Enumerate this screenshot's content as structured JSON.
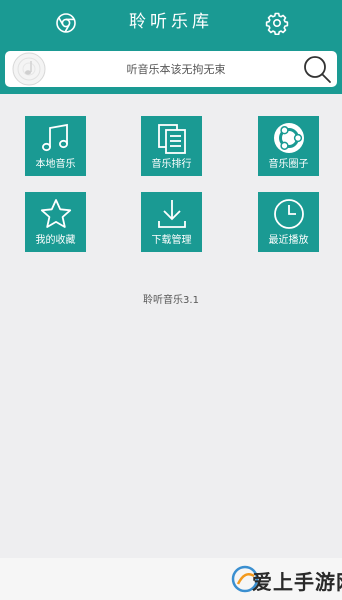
{
  "header": {
    "title": "聆听乐库",
    "left_icon": "chrome-icon",
    "right_icon": "gear-icon"
  },
  "search": {
    "placeholder": "听音乐本该无拘无束",
    "left_icon": "vinyl-record-icon",
    "button_icon": "search-icon"
  },
  "tiles": [
    {
      "label": "本地音乐",
      "icon": "music-note-icon"
    },
    {
      "label": "音乐排行",
      "icon": "stacked-docs-icon"
    },
    {
      "label": "音乐圈子",
      "icon": "ubuntu-circle-icon"
    },
    {
      "label": "我的收藏",
      "icon": "star-icon"
    },
    {
      "label": "下载管理",
      "icon": "download-icon"
    },
    {
      "label": "最近播放",
      "icon": "clock-icon"
    }
  ],
  "footer": {
    "version": "聆听音乐3.1"
  },
  "watermark": {
    "text": "爱上手游网"
  },
  "colors": {
    "primary": "#1a9a93",
    "background": "#eeeef0"
  }
}
